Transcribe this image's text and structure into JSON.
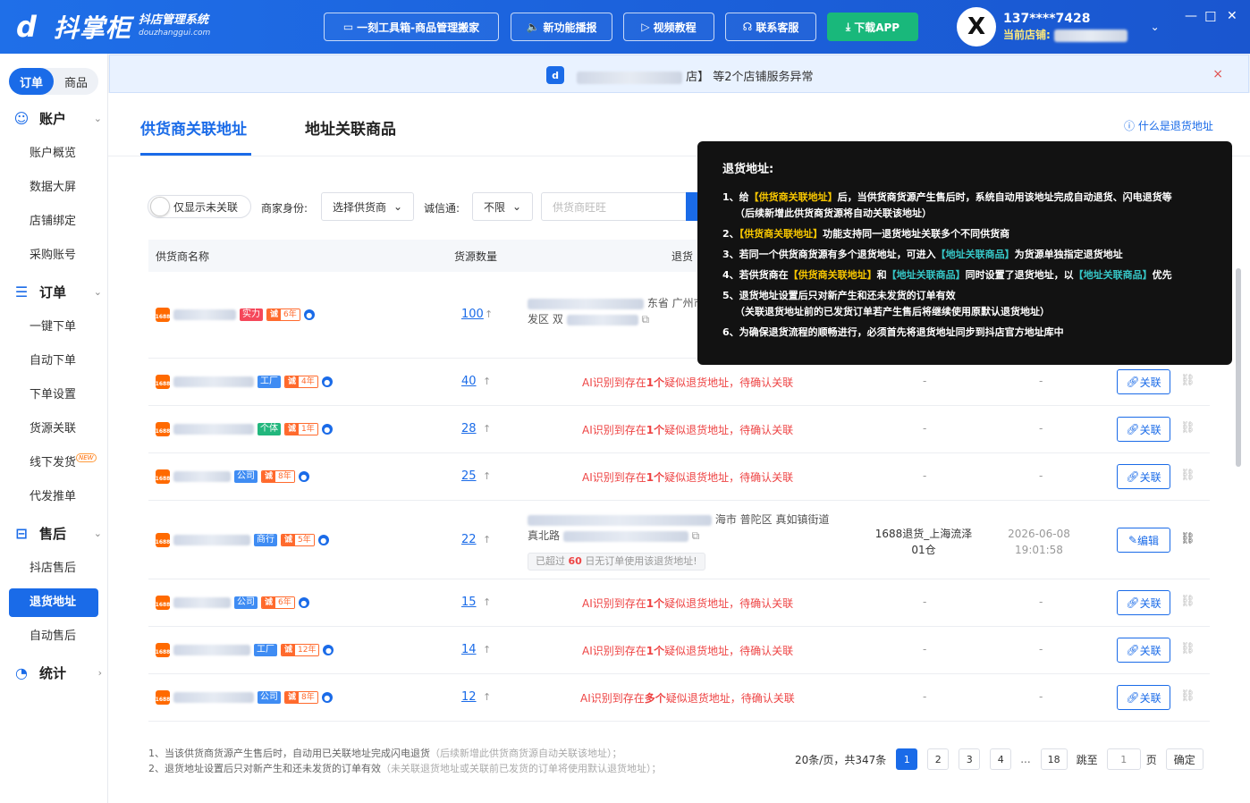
{
  "header": {
    "logo_mark": "d",
    "brand": "抖掌柜",
    "brand_sub": "抖店管理系统",
    "brand_domain": "douzhanggui.com",
    "buttons": [
      "一刻工具箱-商品管理搬家",
      "新功能播报",
      "视频教程",
      "联系客服",
      "下载APP"
    ],
    "user_avatar_letter": "X",
    "user_phone": "137****7428",
    "current_shop_label": "当前店铺:",
    "window_controls": [
      "—",
      "☐",
      "✕"
    ]
  },
  "sidebar": {
    "toggle": [
      "订单",
      "商品"
    ],
    "groups": [
      {
        "label": "账户",
        "items": [
          "账户概览",
          "数据大屏",
          "店铺绑定",
          "采购账号"
        ]
      },
      {
        "label": "订单",
        "items": [
          "一键下单",
          "自动下单",
          "下单设置",
          "货源关联",
          "线下发货",
          "代发推单"
        ]
      },
      {
        "label": "售后",
        "items": [
          "抖店售后",
          "退货地址",
          "自动售后"
        ]
      },
      {
        "label": "统计",
        "items": []
      }
    ],
    "new_tag": "NEW",
    "active_item": "退货地址"
  },
  "notice": {
    "icon": "d",
    "tail": "店】 等2个店铺服务异常",
    "close": "×"
  },
  "tabs": [
    "供货商关联地址",
    "地址关联商品"
  ],
  "help_link": "什么是退货地址",
  "filters": {
    "toggle_label": "仅显示未关联",
    "merchant_label": "商家身份:",
    "merchant_value": "选择供货商",
    "cheng_label": "诚信通:",
    "cheng_value": "不限",
    "search_placeholder": "供货商旺旺"
  },
  "table": {
    "headers": [
      "供货商名称",
      "货源数量",
      "退货"
    ],
    "rows": [
      {
        "tag": "实力",
        "years": "6年",
        "count": "100",
        "addr1": "东省 广州市",
        "addr2": "发区 双"
      },
      {
        "tag": "工厂",
        "years": "4年",
        "count": "40",
        "ai_pre": "AI识别到存在",
        "ai_num": "1个",
        "ai_post": "疑似退货地址，待确认关联",
        "name_col": "-",
        "time_col": "-",
        "action": "关联"
      },
      {
        "tag": "个体",
        "years": "1年",
        "count": "28",
        "ai_pre": "AI识别到存在",
        "ai_num": "1个",
        "ai_post": "疑似退货地址，待确认关联",
        "name_col": "-",
        "time_col": "-",
        "action": "关联"
      },
      {
        "tag": "公司",
        "years": "8年",
        "count": "25",
        "ai_pre": "AI识别到存在",
        "ai_num": "1个",
        "ai_post": "疑似退货地址，待确认关联",
        "name_col": "-",
        "time_col": "-",
        "action": "关联"
      },
      {
        "tag": "商行",
        "years": "5年",
        "count": "22",
        "addr1": "海市 普陀区 真如镇街道",
        "addr2": "真北路",
        "warn_pre": "已超过",
        "warn_num": "60",
        "warn_post": "日无订单使用该退货地址!",
        "name_col": "1688退货_上海流泽01仓",
        "time_col": "2026-06-08 19:01:58",
        "action": "编辑"
      },
      {
        "tag": "公司",
        "years": "6年",
        "count": "15",
        "ai_pre": "AI识别到存在",
        "ai_num": "1个",
        "ai_post": "疑似退货地址，待确认关联",
        "name_col": "-",
        "time_col": "-",
        "action": "关联"
      },
      {
        "tag": "工厂",
        "years": "12年",
        "count": "14",
        "ai_pre": "AI识别到存在",
        "ai_num": "1个",
        "ai_post": "疑似退货地址，待确认关联",
        "name_col": "-",
        "time_col": "-",
        "action": "关联"
      },
      {
        "tag": "公司",
        "years": "8年",
        "count": "12",
        "ai_pre": "AI识别到存在",
        "ai_num": "多个",
        "ai_post": "疑似退货地址，待确认关联",
        "name_col": "-",
        "time_col": "-",
        "action": "关联"
      }
    ],
    "cheng_label": "诚"
  },
  "footnotes": {
    "line1": "1、当该供货商货源产生售后时，自动用已关联地址完成闪电退货",
    "line1_gray": "（后续新增此供货商货源自动关联该地址）；",
    "line2": "2、退货地址设置后只对新产生和还未发货的订单有效",
    "line2_gray": "（未关联退货地址或关联前已发货的订单将使用默认退货地址）；"
  },
  "pager": {
    "summary": "20条/页，共347条",
    "pages": [
      "1",
      "2",
      "3",
      "4",
      "...",
      "18"
    ],
    "jump_label": "跳至",
    "jump_value": "1",
    "page_unit": "页",
    "confirm": "确定"
  },
  "tooltip": {
    "title": "退货地址:",
    "l1a": "1、给",
    "l1b": "【供货商关联地址】",
    "l1c": "后，当供货商货源产生售后时，系统自动用该地址完成自动退货、闪电退货等",
    "l1sub": "（后续新增此供货商货源将自动关联该地址）",
    "l2a": "2、",
    "l2b": "【供货商关联地址】",
    "l2c": "功能支持同一退货地址关联多个不同供货商",
    "l3a": "3、若同一个供货商货源有多个退货地址，可进入",
    "l3b": "【地址关联商品】",
    "l3c": "为货源单独指定退货地址",
    "l4a": "4、若供货商在",
    "l4b": "【供货商关联地址】",
    "l4c": "和",
    "l4d": "【地址关联商品】",
    "l4e": "同时设置了退货地址，以",
    "l4f": "【地址关联商品】",
    "l4g": "优先",
    "l5": "5、退货地址设置后只对新产生和还未发货的订单有效",
    "l5sub": "（关联退货地址前的已发货订单若产生售后将继续使用原默认退货地址）",
    "l6": "6、为确保退货流程的顺畅进行，必须首先将退货地址同步到抖店官方地址库中"
  }
}
